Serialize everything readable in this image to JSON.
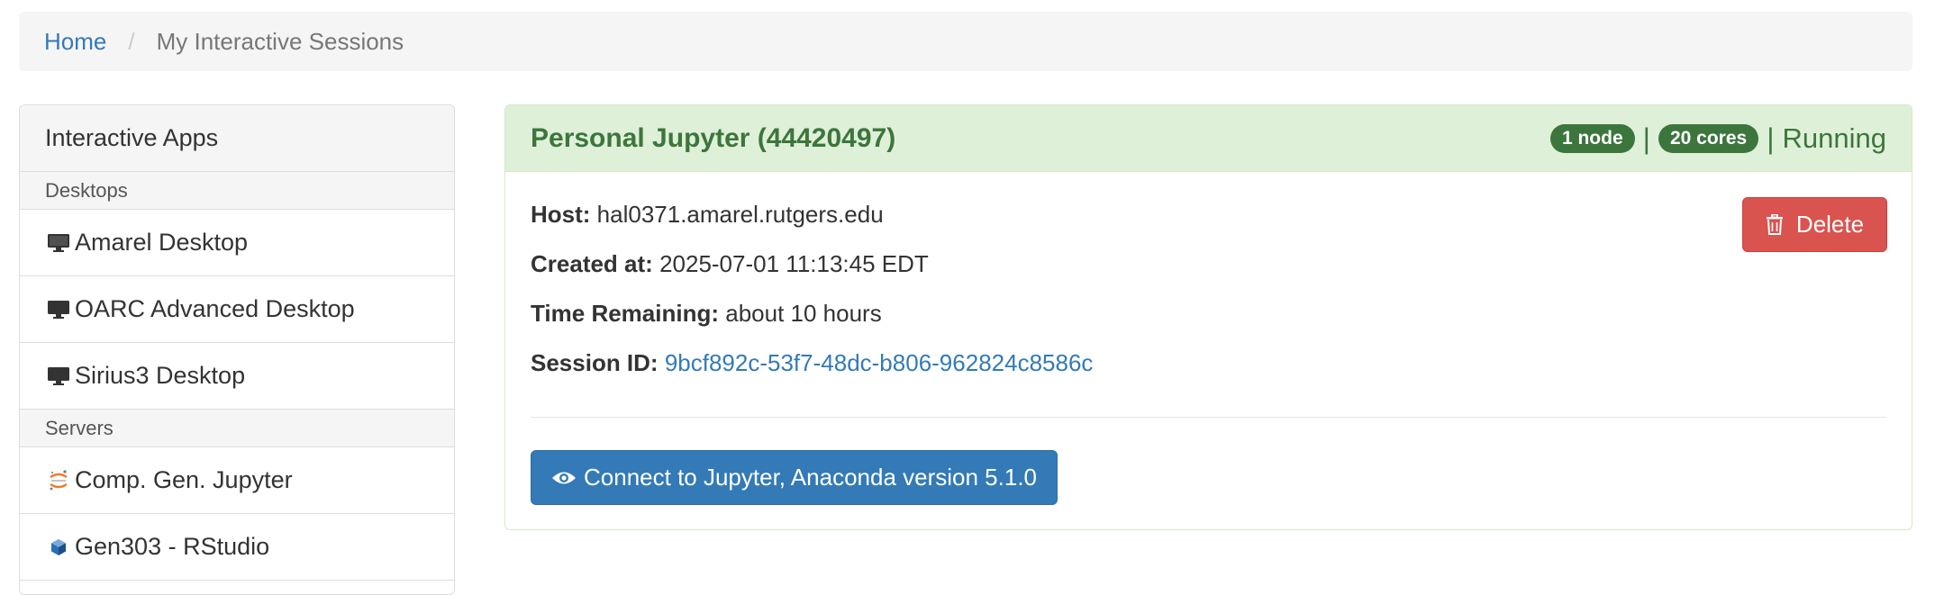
{
  "breadcrumb": {
    "home_label": "Home",
    "separator": "/",
    "current_label": "My Interactive Sessions"
  },
  "sidebar": {
    "heading": "Interactive Apps",
    "groups": [
      {
        "label": "Desktops",
        "items": [
          {
            "label": "Amarel Desktop",
            "icon": "desktop-icon"
          },
          {
            "label": "OARC Advanced Desktop",
            "icon": "desktop-icon"
          },
          {
            "label": "Sirius3 Desktop",
            "icon": "desktop-icon"
          }
        ]
      },
      {
        "label": "Servers",
        "items": [
          {
            "label": "Comp. Gen. Jupyter",
            "icon": "jupyter-icon"
          },
          {
            "label": "Gen303 - RStudio",
            "icon": "rstudio-icon"
          }
        ]
      }
    ]
  },
  "session": {
    "title": "Personal Jupyter (44420497)",
    "nodes_badge": "1 node",
    "cores_badge": "20 cores",
    "separator": "|",
    "status": "Running",
    "host_label": "Host:",
    "host_value": "hal0371.amarel.rutgers.edu",
    "created_label": "Created at:",
    "created_value": "2025-07-01 11:13:45 EDT",
    "time_label": "Time Remaining:",
    "time_value": "about 10 hours",
    "session_id_label": "Session ID:",
    "session_id_value": "9bcf892c-53f7-48dc-b806-962824c8586c",
    "delete_label": "Delete",
    "connect_label": "Connect to Jupyter, Anaconda version 5.1.0"
  },
  "colors": {
    "link": "#337ab7",
    "success_text": "#3c763d",
    "success_bg": "#dff0d8",
    "danger": "#d9534f",
    "primary": "#337ab7"
  }
}
